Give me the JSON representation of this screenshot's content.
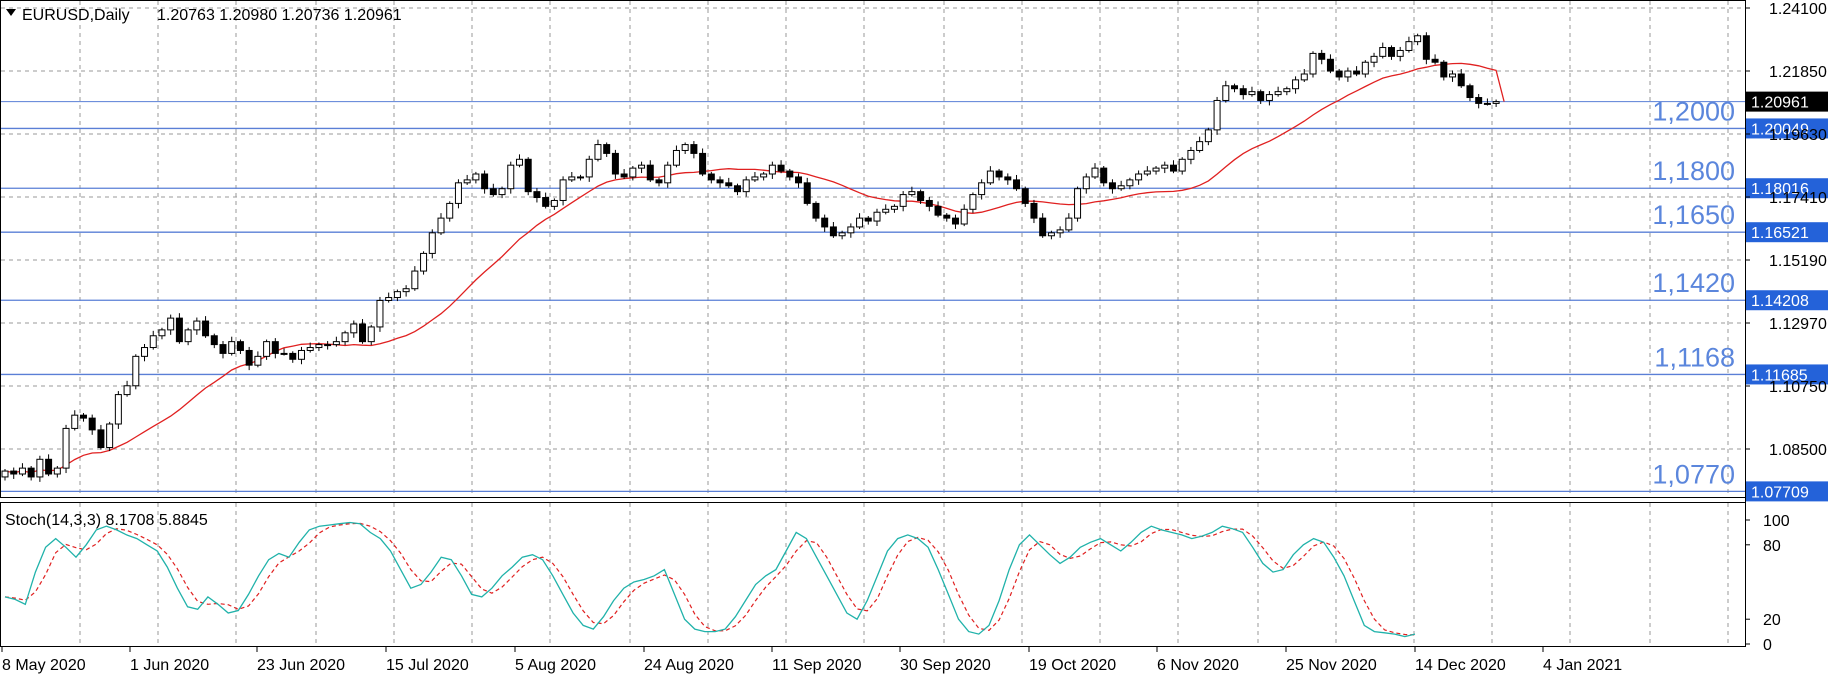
{
  "chart_header": {
    "symbol": "EURUSD,Daily",
    "ohlc": "1.20763 1.20980 1.20736 1.20961"
  },
  "indicator_header": "Stoch(14,3,3) 8.1708 5.8845",
  "colors": {
    "up_candle": "#ffffff",
    "down_candle": "#000000",
    "ma_line": "#e02020",
    "level_line": "#5a7fd6",
    "level_text": "#5b86dc",
    "price_tag": "#2462d9",
    "stoch_main": "#20b2aa",
    "stoch_signal": "#e02020"
  },
  "price_axis_ticks": [
    "1.24100",
    "1.21850",
    "1.19630",
    "1.17410",
    "1.15190",
    "1.12970",
    "1.10750",
    "1.08500"
  ],
  "stoch_axis_ticks": [
    "100",
    "80",
    "20",
    "0"
  ],
  "date_labels": [
    "8 May 2020",
    "1 Jun 2020",
    "23 Jun 2020",
    "15 Jul 2020",
    "5 Aug 2020",
    "24 Aug 2020",
    "11 Sep 2020",
    "30 Sep 2020",
    "19 Oct 2020",
    "6 Nov 2020",
    "25 Nov 2020",
    "14 Dec 2020",
    "4 Jan 2021"
  ],
  "levels": [
    {
      "text": "1,2000",
      "tag": "1.20049",
      "price": 1.20049
    },
    {
      "text": "1,1800",
      "tag": "1.18016",
      "price": 1.18016
    },
    {
      "text": "1,1650",
      "tag": "1.16521",
      "price": 1.16521
    },
    {
      "text": "1,1420",
      "tag": "1.14208",
      "price": 1.14208
    },
    {
      "text": "1,1168",
      "tag": "1.11685",
      "price": 1.11685
    },
    {
      "text": "1,0770",
      "tag": "1.07709",
      "price": 1.07709
    }
  ],
  "current_price": {
    "tag": "1.20961",
    "price": 1.20961
  },
  "chart_data": {
    "type": "candlestick",
    "title": "EURUSD,Daily",
    "ylim": [
      1.0762,
      1.2428
    ],
    "candle_closes": [
      1.084,
      1.083,
      1.085,
      1.082,
      1.088,
      1.083,
      1.085,
      1.0985,
      1.103,
      1.102,
      1.098,
      1.092,
      1.1,
      1.11,
      1.113,
      1.123,
      1.126,
      1.13,
      1.132,
      1.136,
      1.128,
      1.132,
      1.135,
      1.13,
      1.127,
      1.124,
      1.128,
      1.125,
      1.12,
      1.123,
      1.128,
      1.124,
      1.124,
      1.122,
      1.125,
      1.126,
      1.127,
      1.127,
      1.128,
      1.131,
      1.134,
      1.128,
      1.133,
      1.142,
      1.143,
      1.145,
      1.146,
      1.152,
      1.158,
      1.165,
      1.17,
      1.175,
      1.182,
      1.183,
      1.185,
      1.18,
      1.178,
      1.18,
      1.188,
      1.19,
      1.179,
      1.177,
      1.174,
      1.176,
      1.183,
      1.184,
      1.184,
      1.19,
      1.195,
      1.192,
      1.185,
      1.184,
      1.187,
      1.188,
      1.183,
      1.182,
      1.188,
      1.193,
      1.195,
      1.192,
      1.185,
      1.183,
      1.182,
      1.181,
      1.179,
      1.183,
      1.184,
      1.185,
      1.188,
      1.186,
      1.184,
      1.182,
      1.175,
      1.17,
      1.167,
      1.164,
      1.165,
      1.167,
      1.17,
      1.169,
      1.172,
      1.173,
      1.174,
      1.178,
      1.179,
      1.176,
      1.174,
      1.171,
      1.17,
      1.168,
      1.173,
      1.178,
      1.182,
      1.186,
      1.184,
      1.183,
      1.18,
      1.175,
      1.17,
      1.164,
      1.165,
      1.166,
      1.17,
      1.18,
      1.184,
      1.187,
      1.182,
      1.18,
      1.181,
      1.183,
      1.185,
      1.186,
      1.187,
      1.188,
      1.186,
      1.19,
      1.193,
      1.196,
      1.2,
      1.21,
      1.215,
      1.214,
      1.212,
      1.213,
      1.21,
      1.212,
      1.213,
      1.214,
      1.217,
      1.219,
      1.226,
      1.224,
      1.22,
      1.218,
      1.22,
      1.219,
      1.223,
      1.225,
      1.228,
      1.225,
      1.227,
      1.23,
      1.232,
      1.224,
      1.223,
      1.218,
      1.219,
      1.215,
      1.211,
      1.209,
      1.209,
      1.2096
    ],
    "ma_period_label": "moving average",
    "stoch_main_values": [
      38,
      36,
      32,
      58,
      78,
      85,
      78,
      70,
      80,
      92,
      95,
      92,
      88,
      85,
      80,
      75,
      62,
      45,
      30,
      28,
      38,
      32,
      25,
      27,
      40,
      55,
      68,
      73,
      70,
      82,
      92,
      95,
      96,
      97,
      98,
      97,
      90,
      85,
      75,
      60,
      45,
      48,
      58,
      70,
      68,
      55,
      40,
      38,
      45,
      55,
      62,
      70,
      72,
      68,
      55,
      40,
      25,
      15,
      12,
      22,
      35,
      45,
      50,
      52,
      55,
      60,
      40,
      20,
      12,
      10,
      10,
      12,
      22,
      35,
      48,
      55,
      60,
      75,
      90,
      85,
      70,
      55,
      40,
      25,
      20,
      35,
      55,
      75,
      85,
      88,
      85,
      78,
      60,
      40,
      20,
      10,
      8,
      15,
      35,
      60,
      80,
      88,
      80,
      72,
      65,
      70,
      78,
      82,
      85,
      80,
      75,
      82,
      90,
      95,
      92,
      90,
      88,
      85,
      87,
      90,
      95,
      93,
      90,
      78,
      65,
      58,
      60,
      72,
      80,
      85,
      82,
      70,
      55,
      35,
      15,
      10,
      9,
      8,
      6,
      8
    ]
  }
}
